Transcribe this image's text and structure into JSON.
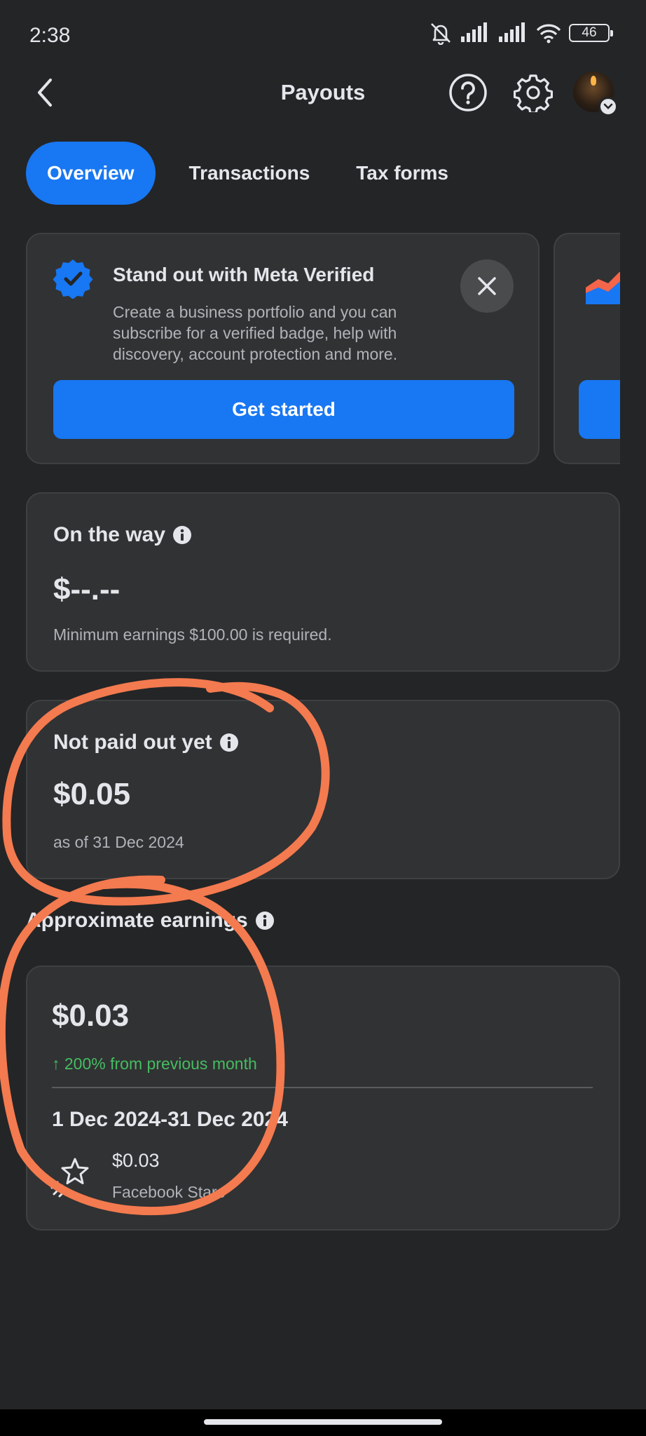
{
  "status_bar": {
    "time": "2:38",
    "battery": "46",
    "icons": [
      "bell-muted-icon",
      "signal-icon",
      "signal-icon",
      "wifi-icon",
      "battery-icon"
    ]
  },
  "header": {
    "title": "Payouts",
    "icons": [
      "back-arrow-icon",
      "help-icon",
      "gear-icon",
      "avatar"
    ]
  },
  "tabs": [
    {
      "label": "Overview",
      "active": true
    },
    {
      "label": "Transactions",
      "active": false
    },
    {
      "label": "Tax forms",
      "active": false
    }
  ],
  "promo": {
    "title": "Stand out with Meta Verified",
    "description": "Create a business portfolio and you can subscribe for a verified badge, help with discovery, account protection and more.",
    "cta": "Get started",
    "icons": [
      "verified-badge-icon",
      "close-icon"
    ]
  },
  "on_the_way": {
    "label": "On the way",
    "amount": "$--.--",
    "note": "Minimum earnings $100.00 is required."
  },
  "not_paid": {
    "label": "Not paid out yet",
    "amount": "$0.05",
    "note": "as of 31 Dec 2024"
  },
  "approx": {
    "heading": "Approximate earnings",
    "amount": "$0.03",
    "trend": "↑ 200% from previous month",
    "date_range": "1 Dec 2024-31 Dec 2024",
    "source_amount": "$0.03",
    "source_label": "Facebook Stars"
  },
  "colors": {
    "background": "#242526",
    "card": "#313233",
    "accent": "#1877f2",
    "positive": "#45bd62",
    "annotation": "#f47a4f"
  }
}
